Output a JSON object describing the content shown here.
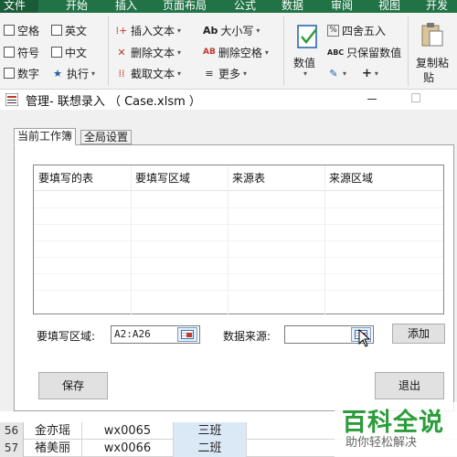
{
  "excel": {
    "menu_tabs": [
      {
        "label": "文件",
        "active": true
      },
      {
        "label": "开始",
        "active": false
      },
      {
        "label": "插入",
        "active": false
      },
      {
        "label": "页面布局",
        "active": false
      },
      {
        "label": "公式",
        "active": false
      },
      {
        "label": "数据",
        "active": false
      },
      {
        "label": "审阅",
        "active": false
      },
      {
        "label": "视图",
        "active": false
      },
      {
        "label": "开发",
        "active": false
      }
    ],
    "checkboxes": [
      "空格",
      "英文",
      "符号",
      "中文",
      "数字"
    ],
    "ribbon_items": {
      "execute": "执行",
      "insert_text": "插入文本",
      "delete_text": "删除文本",
      "extract_text": "截取文本",
      "case_icon": "Ab",
      "case": "大小写",
      "delete_space_icon": "AB",
      "delete_space": "删除空格",
      "more": "更多",
      "numeric": "数值",
      "round": "四舍五入",
      "keep_values_icon": "ABC",
      "keep_values": "只保留数值",
      "plus": "+",
      "copy_paste_1": "复制粘",
      "copy_paste_2": "贴"
    },
    "accent_color": "#217346"
  },
  "dialog": {
    "title": "管理- 联想录入 （ Case.xlsm ）",
    "tabs": [
      {
        "label": "当前工作簿",
        "active": true
      },
      {
        "label": "全局设置",
        "active": false
      }
    ],
    "list_columns": [
      "要填写的表",
      "要填写区域",
      "来源表",
      "来源区域"
    ],
    "fill_range_label": "要填写区域:",
    "fill_range_value": "A2:A26",
    "data_source_label": "数据来源:",
    "data_source_value": "",
    "add_button": "添加",
    "save_button": "保存",
    "exit_button": "退出"
  },
  "sheet": {
    "rows": [
      {
        "num": "56",
        "name": "金亦瑶",
        "code": "wx0065",
        "class": "三班"
      },
      {
        "num": "57",
        "name": "褚美丽",
        "code": "wx0066",
        "class": "二班"
      }
    ]
  },
  "watermark": {
    "main": "百科全说",
    "sub": "助你轻松解决",
    "color": "#2a9d3a"
  }
}
